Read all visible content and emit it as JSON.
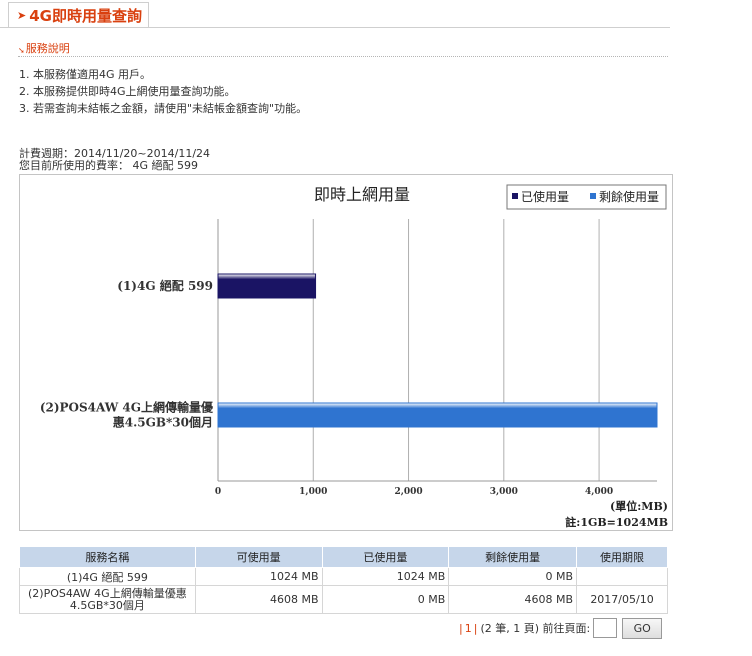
{
  "header": {
    "arrow": "➤",
    "title": "4G即時用量查詢"
  },
  "service_info": {
    "arrow": "➘",
    "title": "服務說明",
    "items": [
      "1. 本服務僅適用4G 用戶。",
      "2. 本服務提供即時4G上網使用量查詢功能。",
      "3. 若需查詢未結帳之金額，請使用\"未結帳金額查詢\"功能。"
    ]
  },
  "billing": {
    "period": "計費週期：2014/11/20~2014/11/24",
    "plan": "您目前所使用的費率： 4G 絕配 599"
  },
  "chart_data": {
    "type": "bar",
    "orientation": "horizontal",
    "title": "即時上網用量",
    "categories": [
      "(1)4G 絕配 599",
      "(2)POS4AW 4G上網傳輸量優惠4.5GB*30個月"
    ],
    "category_lines": [
      [
        "(1)4G 絕配 599"
      ],
      [
        "(2)POS4AW 4G上網傳輸量優",
        "惠4.5GB*30個月"
      ]
    ],
    "series": [
      {
        "name": "已使用量",
        "values": [
          1024,
          0
        ],
        "color": "#1a1464"
      },
      {
        "name": "剩餘使用量",
        "values": [
          0,
          4608
        ],
        "color": "#2f74d0"
      }
    ],
    "xlim": [
      0,
      4608
    ],
    "xticks": [
      0,
      1000,
      2000,
      3000,
      4000
    ],
    "xtick_labels": [
      "0",
      "1,000",
      "2,000",
      "3,000",
      "4,000"
    ],
    "unit_label": "(單位:MB)",
    "note": "註:1GB=1024MB",
    "legend_position": "top-right",
    "grid": true
  },
  "table": {
    "headers": [
      "服務名稱",
      "可使用量",
      "已使用量",
      "剩餘使用量",
      "使用期限"
    ],
    "rows": [
      {
        "name": "(1)4G 絕配 599",
        "available": "1024 MB",
        "used": "1024 MB",
        "remaining": "0 MB",
        "expiry": ""
      },
      {
        "name": "(2)POS4AW 4G上網傳輸量優惠4.5GB*30個月",
        "available": "4608 MB",
        "used": "0 MB",
        "remaining": "4608 MB",
        "expiry": "2017/05/10"
      }
    ]
  },
  "pager": {
    "sep_left": "|",
    "current": "1",
    "sep_right": "|",
    "summary": "(2 筆, 1 頁) 前往頁面:",
    "input_value": "",
    "go_label": "GO"
  }
}
